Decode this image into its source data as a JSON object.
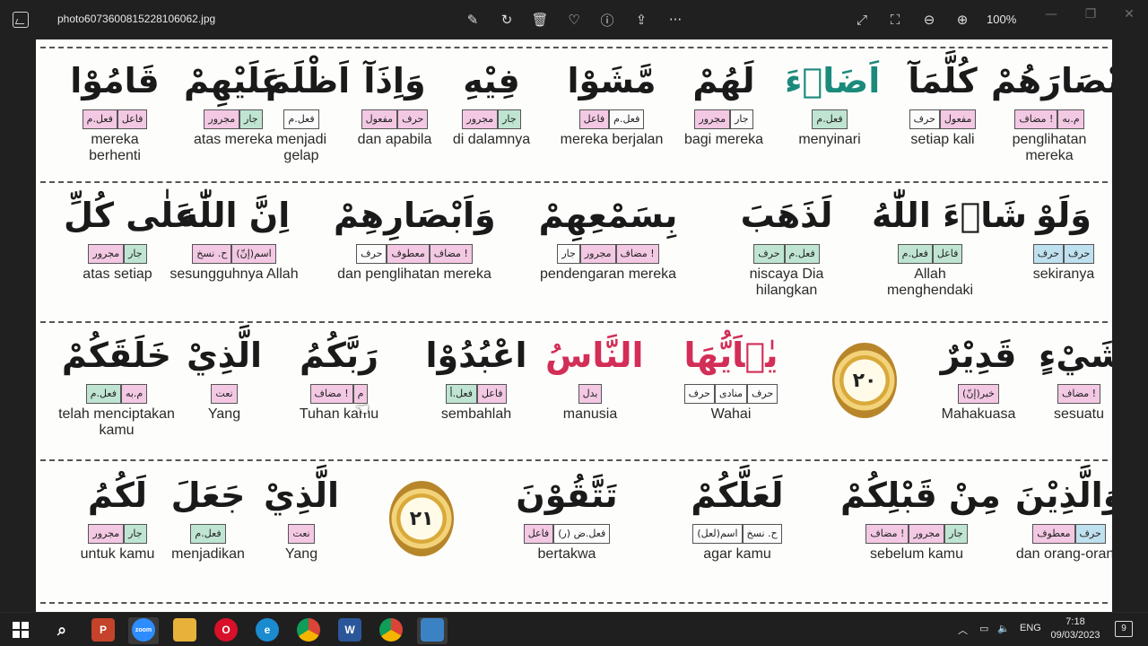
{
  "window": {
    "title": "photo6073600815228106062.jpg",
    "zoom": "100%",
    "icons": [
      "image-app-icon",
      "edit-icon",
      "rotate-icon",
      "delete-icon",
      "favorite-icon",
      "info-icon",
      "share-icon",
      "more-icon",
      "expand-icon",
      "fullscreen-icon",
      "zoom-out-icon",
      "zoom-in-icon"
    ],
    "more_label": "···"
  },
  "rows": [
    {
      "words": [
        {
          "ar": "قَامُوْا",
          "color": "dark",
          "tags": [
            {
              "t": "فعل.م",
              "c": "pink"
            },
            {
              "t": "فاعل",
              "c": "pink"
            }
          ],
          "tr": "mereka berhenti"
        },
        {
          "ar": "عَلَيْهِمْ",
          "color": "dark",
          "tags": [
            {
              "t": "مجرور",
              "c": "pink"
            },
            {
              "t": "جار",
              "c": "green"
            }
          ],
          "tr": "atas mereka"
        },
        {
          "ar": "اَظْلَمَ",
          "color": "dark",
          "tags": [
            {
              "t": "فعل.م",
              "c": "white"
            }
          ],
          "tr": "menjadi gelap"
        },
        {
          "ar": "وَاِذَآ",
          "color": "mixed",
          "tags": [
            {
              "t": "مفعول",
              "c": "pink"
            },
            {
              "t": "حرف",
              "c": "pink"
            }
          ],
          "tr": "dan apabila"
        },
        {
          "ar": "فِيْهِ",
          "color": "dark",
          "tags": [
            {
              "t": "مجرور",
              "c": "pink"
            },
            {
              "t": "جار",
              "c": "green"
            }
          ],
          "tr": "di dalamnya"
        },
        {
          "ar": "مَّشَوْا",
          "color": "mixed",
          "tags": [
            {
              "t": "فاعل",
              "c": "pink"
            },
            {
              "t": "فعل.م",
              "c": "white"
            }
          ],
          "tr": "mereka berjalan"
        },
        {
          "ar": "لَهُمْ",
          "color": "mixed",
          "tags": [
            {
              "t": "مجرور",
              "c": "pink"
            },
            {
              "t": "جار",
              "c": "white"
            }
          ],
          "tr": "bagi mereka"
        },
        {
          "ar": "اَضَاۤءَ",
          "color": "green",
          "tags": [
            {
              "t": "فعل.م",
              "c": "green"
            }
          ],
          "tr": "menyinari"
        },
        {
          "ar": "كُلَّمَآ",
          "color": "mixed",
          "tags": [
            {
              "t": "حرف",
              "c": "white"
            },
            {
              "t": "مفعول",
              "c": "pink"
            }
          ],
          "tr": "setiap kali"
        },
        {
          "ar": "اَبْصَارَهُمْ",
          "color": "dark",
          "tags": [
            {
              "t": "مضاف !",
              "c": "pink"
            },
            {
              "t": "م.به",
              "c": "pink"
            }
          ],
          "tr": "penglihatan mereka"
        }
      ]
    },
    {
      "words": [
        {
          "ar": "عَلٰى كُلِّ",
          "color": "dark",
          "tags": [
            {
              "t": "مجرور",
              "c": "pink"
            },
            {
              "t": "جار",
              "c": "green"
            }
          ],
          "tr": "atas setiap"
        },
        {
          "ar": "اِنَّ اللّٰهَ",
          "color": "mixed",
          "tags": [
            {
              "t": "ح. نسخ",
              "c": "pink"
            },
            {
              "t": "اسم(إنّ)",
              "c": "pink"
            }
          ],
          "tr": "sesungguhnya Allah"
        },
        {
          "ar": "وَاَبْصَارِهِمْ",
          "color": "dark",
          "tags": [
            {
              "t": "حرف",
              "c": "white"
            },
            {
              "t": "معطوف",
              "c": "pink"
            },
            {
              "t": "مضاف !",
              "c": "pink"
            }
          ],
          "tr": "dan penglihatan mereka"
        },
        {
          "ar": "بِسَمْعِهِمْ",
          "color": "dark",
          "tags": [
            {
              "t": "جار",
              "c": "white"
            },
            {
              "t": "مجرور",
              "c": "pink"
            },
            {
              "t": "مضاف !",
              "c": "pink"
            }
          ],
          "tr": "pendengaran mereka"
        },
        {
          "ar": "لَذَهَبَ",
          "color": "dark",
          "tags": [
            {
              "t": "حرف",
              "c": "green"
            },
            {
              "t": "فعل.م",
              "c": "green"
            }
          ],
          "tr": "niscaya Dia hilangkan"
        },
        {
          "ar": "شَاۤءَ اللّٰهُ",
          "color": "mixed",
          "tags": [
            {
              "t": "فعل.م",
              "c": "green"
            },
            {
              "t": "فاعل",
              "c": "green"
            }
          ],
          "tr": "Allah menghendaki"
        },
        {
          "ar": "وَلَوْ",
          "color": "dark",
          "tags": [
            {
              "t": "حرف",
              "c": "blue"
            },
            {
              "t": "حرف",
              "c": "blue"
            }
          ],
          "tr": "sekiranya"
        }
      ]
    },
    {
      "words": [
        {
          "ar": "خَلَقَكُمْ",
          "color": "dark",
          "tags": [
            {
              "t": "فعل.م",
              "c": "green"
            },
            {
              "t": "م.به",
              "c": "pink"
            }
          ],
          "tr": "telah menciptakan kamu"
        },
        {
          "ar": "الَّذِيْ",
          "color": "dark",
          "tags": [
            {
              "t": "نعت",
              "c": "pink"
            }
          ],
          "tr": "Yang"
        },
        {
          "ar": "رَبَّكُمُ",
          "color": "dark",
          "tags": [
            {
              "t": "مضاف !",
              "c": "pink"
            },
            {
              "t": "م",
              "c": "pink"
            }
          ],
          "tr": "Tuhan kamu"
        },
        {
          "ar": "اعْبُدُوْا",
          "color": "dark",
          "tags": [
            {
              "t": "فعل.أ",
              "c": "green"
            },
            {
              "t": "فاعل",
              "c": "pink"
            }
          ],
          "tr": "sembahlah"
        },
        {
          "ar": "النَّاسُ",
          "color": "red",
          "tags": [
            {
              "t": "بدل",
              "c": "pink"
            }
          ],
          "tr": "manusia"
        },
        {
          "ar": "يٰۤاَيُّهَا",
          "color": "red",
          "tags": [
            {
              "t": "حرف",
              "c": "white"
            },
            {
              "t": "منادى",
              "c": "white"
            },
            {
              "t": "حرف",
              "c": "white"
            }
          ],
          "tr": "Wahai"
        },
        {
          "ar": "قَدِيْرٌ",
          "color": "dark",
          "tags": [
            {
              "t": "خبر(إنّ)",
              "c": "pink"
            }
          ],
          "tr": "Mahakuasa"
        },
        {
          "ar": "شَيْءٍ",
          "color": "dark",
          "tags": [
            {
              "t": "مضاف !",
              "c": "pink"
            }
          ],
          "tr": "sesuatu"
        }
      ],
      "medallion": "٢٠"
    },
    {
      "words": [
        {
          "ar": "لَكُمُ",
          "color": "dark",
          "tags": [
            {
              "t": "مجرور",
              "c": "pink"
            },
            {
              "t": "جار",
              "c": "green"
            }
          ],
          "tr": "untuk kamu"
        },
        {
          "ar": "جَعَلَ",
          "color": "dark",
          "tags": [
            {
              "t": "فعل.م",
              "c": "green"
            }
          ],
          "tr": "menjadikan"
        },
        {
          "ar": "الَّذِيْ",
          "color": "dark",
          "tags": [
            {
              "t": "نعت",
              "c": "pink"
            }
          ],
          "tr": "Yang"
        },
        {
          "ar": "تَتَّقُوْنَ",
          "color": "dark",
          "tags": [
            {
              "t": "فاعل",
              "c": "pink"
            },
            {
              "t": "فعل.ض (ر)",
              "c": "white"
            }
          ],
          "tr": "bertakwa"
        },
        {
          "ar": "لَعَلَّكُمْ",
          "color": "dark",
          "tags": [
            {
              "t": "اسم(لعل)",
              "c": "white"
            },
            {
              "t": "ح. نسخ",
              "c": "white"
            }
          ],
          "tr": "agar kamu"
        },
        {
          "ar": "مِنْ قَبْلِكُمْ",
          "color": "dark",
          "tags": [
            {
              "t": "مضاف !",
              "c": "pink"
            },
            {
              "t": "مجرور",
              "c": "pink"
            },
            {
              "t": "جار",
              "c": "green"
            }
          ],
          "tr": "sebelum kamu"
        },
        {
          "ar": "وَالَّذِيْنَ",
          "color": "dark",
          "tags": [
            {
              "t": "معطوف",
              "c": "pink"
            },
            {
              "t": "حرف",
              "c": "blue"
            }
          ],
          "tr": "dan orang-orang"
        }
      ],
      "medallion": "٢١"
    }
  ],
  "taskbar": {
    "items": [
      "windows-start-icon",
      "search-icon",
      "powerpoint-icon",
      "zoom-icon",
      "file-explorer-icon",
      "opera-icon",
      "edge-icon",
      "chrome-icon",
      "word-icon",
      "chrome-profile-icon",
      "photos-icon"
    ],
    "zoom_label": "zoom",
    "tray_lang": "ENG",
    "time": "7:18",
    "date": "09/03/2023",
    "notification_count": "9"
  }
}
